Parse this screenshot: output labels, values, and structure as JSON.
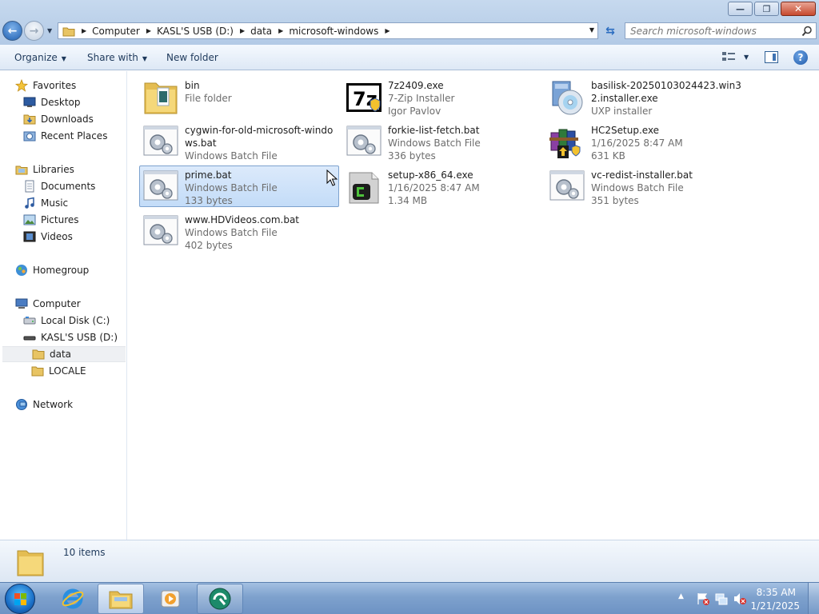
{
  "window": {
    "minimize_glyph": "—",
    "restore_glyph": "❐",
    "close_glyph": "✕"
  },
  "address": {
    "crumbs": [
      "Computer",
      "KASL'S USB (D:)",
      "data",
      "microsoft-windows"
    ],
    "search_placeholder": "Search microsoft-windows"
  },
  "toolbar": {
    "organize": "Organize",
    "share_with": "Share with",
    "new_folder": "New folder"
  },
  "nav": {
    "favorites": "Favorites",
    "desktop": "Desktop",
    "downloads": "Downloads",
    "recent_places": "Recent Places",
    "libraries": "Libraries",
    "documents": "Documents",
    "music": "Music",
    "pictures": "Pictures",
    "videos": "Videos",
    "homegroup": "Homegroup",
    "computer": "Computer",
    "local_disk": "Local Disk (C:)",
    "usb": "KASL'S USB (D:)",
    "data": "data",
    "locale": "LOCALE",
    "network": "Network"
  },
  "files": [
    {
      "name": "bin",
      "line1": "File folder",
      "line2": "",
      "icon": "folder-icon"
    },
    {
      "name": "cygwin-for-old-microsoft-windows.bat",
      "line1": "Windows Batch File",
      "line2": "",
      "icon": "batch-file-icon"
    },
    {
      "name": "prime.bat",
      "line1": "Windows Batch File",
      "line2": "133 bytes",
      "icon": "batch-file-icon"
    },
    {
      "name": "www.HDVideos.com.bat",
      "line1": "Windows Batch File",
      "line2": "402 bytes",
      "icon": "batch-file-icon"
    },
    {
      "name": "7z2409.exe",
      "line1": "7-Zip Installer",
      "line2": "Igor Pavlov",
      "icon": "7zip-icon"
    },
    {
      "name": "forkie-list-fetch.bat",
      "line1": "Windows Batch File",
      "line2": "336 bytes",
      "icon": "batch-file-icon"
    },
    {
      "name": "setup-x86_64.exe",
      "line1": "1/16/2025 8:47 AM",
      "line2": "1.34 MB",
      "icon": "cygwin-setup-icon"
    },
    {
      "name": "basilisk-20250103024423.win32.installer.exe",
      "line1": "UXP installer",
      "line2": "",
      "icon": "installer-disc-icon"
    },
    {
      "name": "HC2Setup.exe",
      "line1": "1/16/2025 8:47 AM",
      "line2": "631 KB",
      "icon": "winrar-setup-icon"
    },
    {
      "name": "vc-redist-installer.bat",
      "line1": "Windows Batch File",
      "line2": "351 bytes",
      "icon": "batch-file-icon"
    }
  ],
  "details": {
    "count": "10 items"
  },
  "taskbar": {
    "time": "8:35 AM",
    "date": "1/21/2025",
    "tray_arrow": "▲"
  },
  "colors": {
    "selection": "#cce0f8",
    "chrome": "#b9cfe9",
    "taskbar": "#7ea1cd"
  }
}
